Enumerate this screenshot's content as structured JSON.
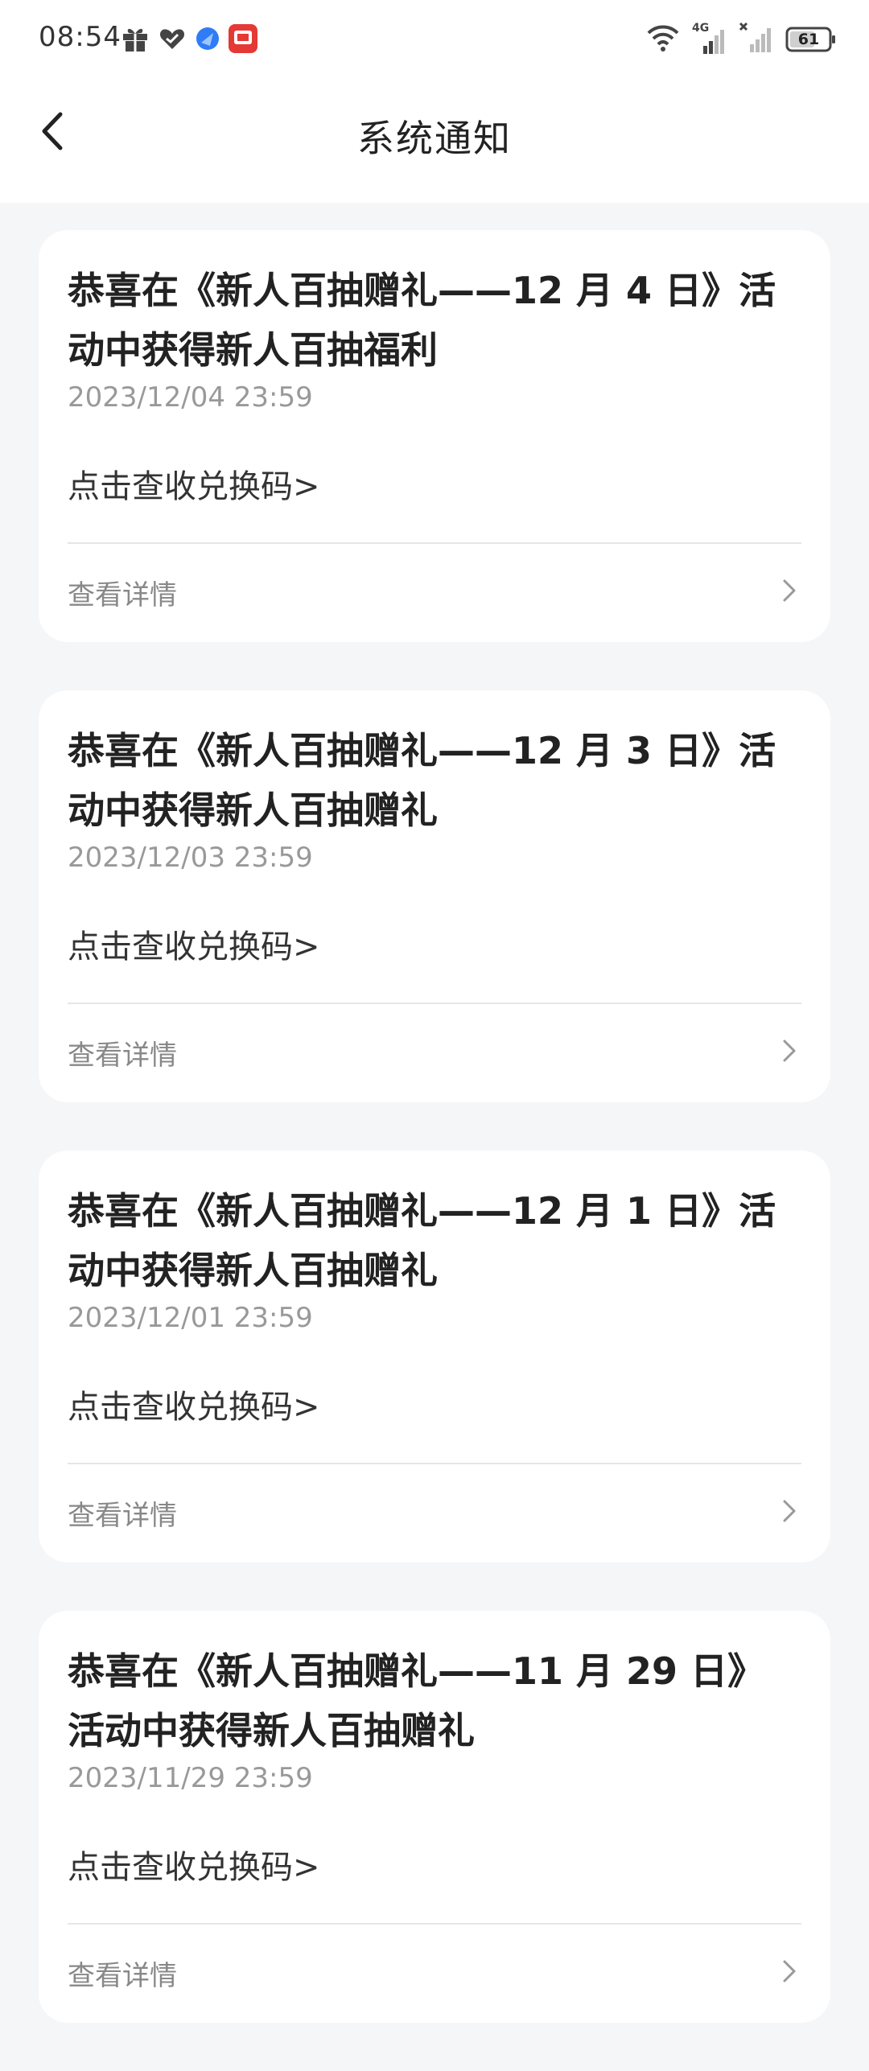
{
  "status_bar": {
    "time": "08:54",
    "battery": "61",
    "network": "4G",
    "icons_left": [
      "gift-icon",
      "heart-icon",
      "browser-icon",
      "red-app-icon"
    ],
    "icons_right": [
      "wifi-icon",
      "signal-4g-icon",
      "signal-no-sim-icon",
      "battery-icon"
    ]
  },
  "header": {
    "title": "系统通知",
    "back_icon": "chevron-left-icon"
  },
  "notifications": [
    {
      "title": "恭喜在《新人百抽赠礼——12 月 4 日》活动中获得新人百抽福利",
      "date": "2023/12/04 23:59",
      "link": "点击查收兑换码>",
      "detail": "查看详情"
    },
    {
      "title": "恭喜在《新人百抽赠礼——12 月 3 日》活动中获得新人百抽赠礼",
      "date": "2023/12/03 23:59",
      "link": "点击查收兑换码>",
      "detail": "查看详情"
    },
    {
      "title": "恭喜在《新人百抽赠礼——12 月 1 日》活动中获得新人百抽赠礼",
      "date": "2023/12/01 23:59",
      "link": "点击查收兑换码>",
      "detail": "查看详情"
    },
    {
      "title": "恭喜在《新人百抽赠礼——11 月 29 日》活动中获得新人百抽赠礼",
      "date": "2023/11/29 23:59",
      "link": "点击查收兑换码>",
      "detail": "查看详情"
    }
  ],
  "colors": {
    "background": "#F5F6F8",
    "card": "#FFFFFF",
    "title_text": "#222222",
    "date_text": "#999999",
    "red_app": "#E53935",
    "browser_blue": "#2F7CF6"
  }
}
